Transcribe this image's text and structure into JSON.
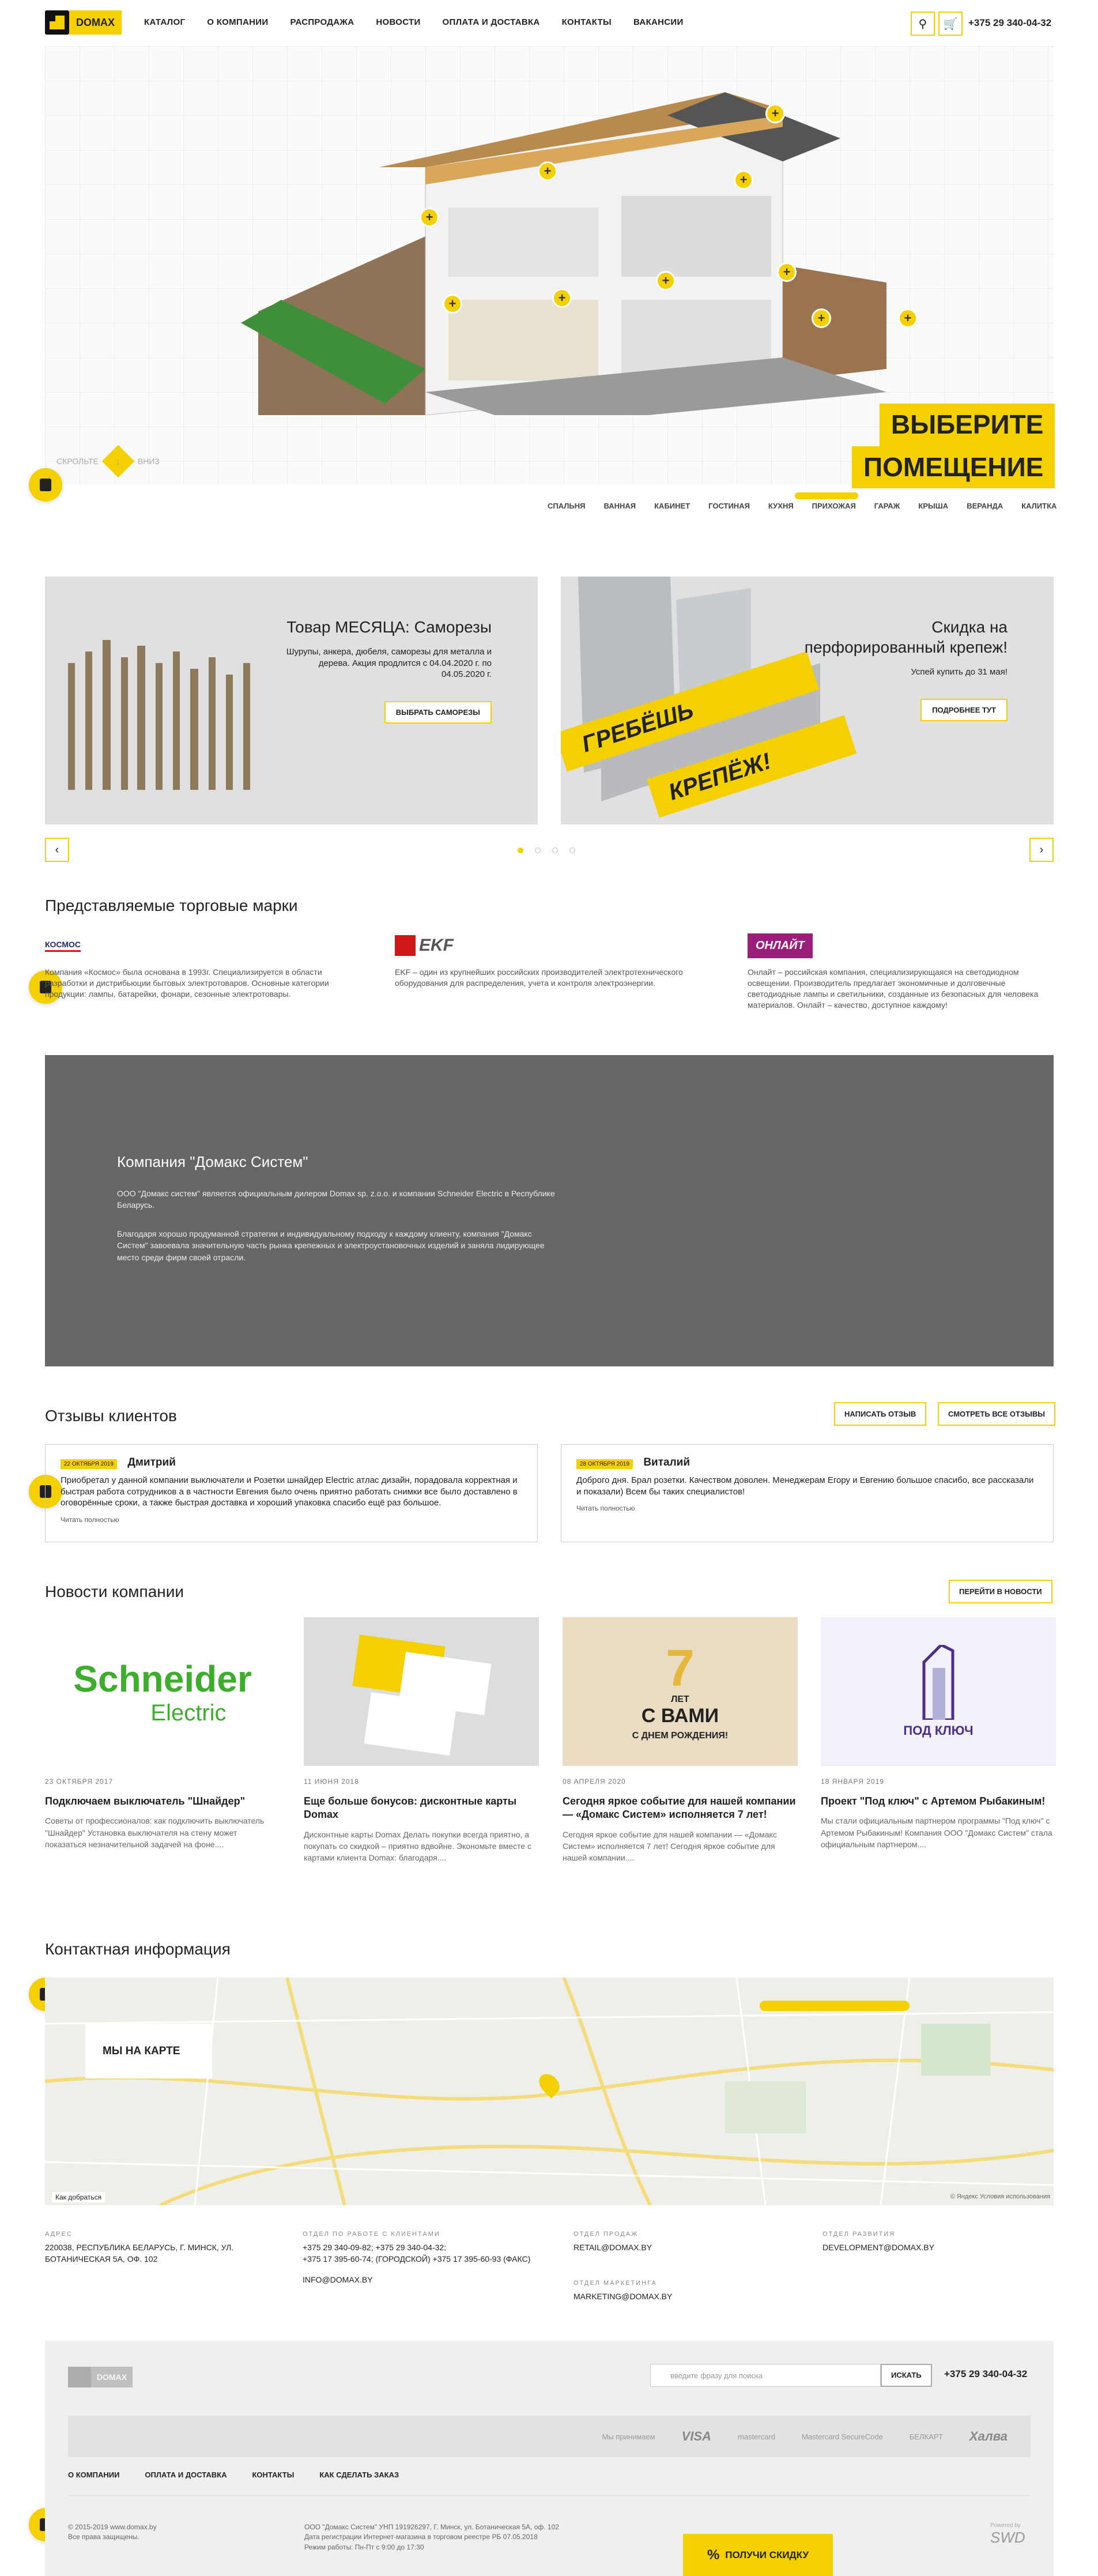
{
  "header": {
    "logo_text": "DOMAX",
    "nav": [
      "КАТАЛОГ",
      "О КОМПАНИИ",
      "РАСПРОДАЖА",
      "НОВОСТИ",
      "ОПЛАТА И ДОСТАВКА",
      "КОНТАКТЫ",
      "ВАКАНСИИ"
    ],
    "phone": "+375 29 340-04-32"
  },
  "hero": {
    "title_line1": "ВЫБЕРИТЕ",
    "title_line2": "ПОМЕЩЕНИЕ",
    "scroll_up": "СКРОЛЬТЕ",
    "scroll_down": "ВНИЗ",
    "rooms": [
      "СПАЛЬНЯ",
      "ВАННАЯ",
      "КАБИНЕТ",
      "ГОСТИНАЯ",
      "КУХНЯ",
      "ПРИХОЖАЯ",
      "ГАРАЖ",
      "КРЫША",
      "ВЕРАНДА",
      "КАЛИТКА"
    ]
  },
  "promos": [
    {
      "title": "Товар МЕСЯЦА: Саморезы",
      "text": "Шурупы, анкера, дюбеля, саморезы для металла и дерева. Акция продлится с 04.04.2020 г. по 04.05.2020 г.",
      "button": "ВЫБРАТЬ САМОРЕЗЫ"
    },
    {
      "title": "Скидка на перфорированный крепеж!",
      "text": "Успей купить до 31 мая!",
      "button": "ПОДРОБНЕЕ ТУТ",
      "banner_1": "ГРЕБЁШЬ",
      "banner_2": "КРЕПЁЖ!"
    }
  ],
  "brands": {
    "title": "Представляемые торговые марки",
    "items": [
      {
        "logo": "КОСМОС",
        "text": "Компания «Космос» была основана в 1993г. Специализируется в области разработки и дистрибьюции бытовых электротоваров. Основные категории продукции: лампы, батарейки, фонари, сезонные электротовары."
      },
      {
        "logo": "EKF",
        "text": "EKF – один из крупнейших российских производителей электротехнического оборудования для распределения, учета и контроля электроэнергии."
      },
      {
        "logo": "ОНЛАЙТ",
        "text": "Онлайт – российская компания, специализирующаяся на светодиодном освещении. Производитель предлагает экономичные и долговечные светодиодные лампы и светильники, созданные из безопасных для человека материалов. Онлайт – качество, доступное каждому!"
      }
    ]
  },
  "company": {
    "title": "Компания \"Домакс Систем\"",
    "p1": "ООО \"Домакс систем\" является официальным дилером Domax sp. z.o.o. и компании Schneider Electric в Республике Беларусь.",
    "p2": "Благодаря хорошо продуманной стратегии и индивидуальному подходу к каждому клиенту, компания \"Домакс Систем\" завоевала значительную часть рынка крепежных и электроустановочных изделий и заняла лидирующее место среди фирм своей отрасли."
  },
  "reviews": {
    "title": "Отзывы клиентов",
    "write_btn": "НАПИСАТЬ ОТЗЫВ",
    "all_btn": "СМОТРЕТЬ ВСЕ ОТЗЫВЫ",
    "items": [
      {
        "date": "22 ОКТЯБРЯ 2019",
        "name": "Дмитрий",
        "text": "Приобретал у данной компании выключатели и Розетки шнайдер Electric атлас дизайн, порадовала корректная и быстрая работа сотрудников а в частности Евгения было очень приятно работать снимки все было доставлено в оговорённые сроки, а также быстрая доставка и хороший упаковка спасибо ещё раз большое.",
        "more": "Читать полностью"
      },
      {
        "date": "28 ОКТЯБРЯ 2019",
        "name": "Виталий",
        "text": "Доброго дня. Брал розетки. Качеством доволен. Менеджерам Егору и Евгению большое спасибо, все рассказали и показали) Всем бы таких специалистов!",
        "more": "Читать полностью"
      }
    ]
  },
  "news": {
    "title": "Новости компании",
    "all_btn": "ПЕРЕЙТИ В НОВОСТИ",
    "items": [
      {
        "date": "23 ОКТЯБРЯ 2017",
        "title": "Подключаем выключатель \"Шнайдер\"",
        "text": "Советы от профессионалов: как подключить выключатель \"Шнайдер\" Установка выключателя на стену может показаться незначительной задачей на фоне...."
      },
      {
        "date": "11 ИЮНЯ 2018",
        "title": "Еще больше бонусов: дисконтные карты Domax",
        "text": "Дисконтные карты Domax Делать покупки всегда приятно, а покупать со скидкой – приятно вдвойне. Экономьте вместе с картами клиента Domax: благодаря...."
      },
      {
        "date": "08 АПРЕЛЯ 2020",
        "title": "Сегодня яркое событие для нашей компании — «Домакс Систем» исполняется 7 лет!",
        "text": "Сегодня яркое событие для нашей компании — «Домакс Систем» исполняется 7 лет! Сегодня яркое событие для нашей компании...."
      },
      {
        "date": "18 ЯНВАРЯ 2019",
        "title": "Проект \"Под ключ\" с Артемом Рыбакиным!",
        "text": "Мы стали официальным партнером программы \"Под ключ\" с Артемом Рыбакиным! Компания ООО \"Домакс Систем\" стала официальным партнером...."
      }
    ],
    "schneider_1": "Schneider",
    "schneider_2": "Electric",
    "bday_num": "7",
    "bday_1": "ЛЕТ",
    "bday_2": "С ВАМИ",
    "bday_3": "С ДНЕМ РОЖДЕНИЯ!",
    "podkluch": "ПОД КЛЮЧ"
  },
  "contacts": {
    "title": "Контактная информация",
    "map_label": "МЫ НА КАРТЕ",
    "map_route": "Как добраться",
    "map_terms": "© Яндекс Условия использования",
    "address_lbl": "АДРЕС",
    "address": "220038, РЕСПУБЛИКА БЕЛАРУСЬ, Г. МИНСК, УЛ. БОТАНИЧЕСКАЯ 5А, ОФ. 102",
    "clients_lbl": "ОТДЕЛ ПО РАБОТЕ С КЛИЕНТАМИ",
    "clients_l1": "+375 29 340-09-82; +375 29 340-04-32;",
    "clients_l2": "+375 17 395-60-74; (ГОРОДСКОЙ) +375 17 395-60-93 (ФАКС)",
    "clients_mail": "INFO@DOMAX.BY",
    "sales_lbl": "ОТДЕЛ ПРОДАЖ",
    "sales_mail": "RETAIL@DOMAX.BY",
    "marketing_lbl": "ОТДЕЛ МАРКЕТИНГА",
    "marketing_mail": "MARKETING@DOMAX.BY",
    "dev_lbl": "ОТДЕЛ РАЗВИТИЯ",
    "dev_mail": "DEVELOPMENT@DOMAX.BY"
  },
  "footer": {
    "logo_text": "DOMAX",
    "search_placeholder": "введите фразу для поиска",
    "search_btn": "ИСКАТЬ",
    "phone": "+375 29 340-04-32",
    "pay_label": "Мы принимаем",
    "pay": [
      "VISA",
      "mastercard",
      "Mastercard SecureCode",
      "БЕЛКАРТ",
      "Халва"
    ],
    "nav": [
      "О КОМПАНИИ",
      "ОПЛАТА И ДОСТАВКА",
      "КОНТАКТЫ",
      "КАК СДЕЛАТЬ ЗАКАЗ"
    ],
    "copy1": "© 2015-2019 www.domax.by",
    "copy2": "Все права защищены.",
    "req1": "ООО \"Домакс Систем\" УНП 191926297, Г. Минск, ул. Ботаническая 5А, оф. 102",
    "req2": "Дата регистрации Интернет-магазина в торговом реестре РБ 07.05.2018",
    "req3": "Режим работы: Пн-Пт с 9:00 до 17:30",
    "powered": "Powered by",
    "discount": "ПОЛУЧИ СКИДКУ"
  },
  "colors": {
    "accent": "#f5d000",
    "dark_band": "#666666"
  }
}
